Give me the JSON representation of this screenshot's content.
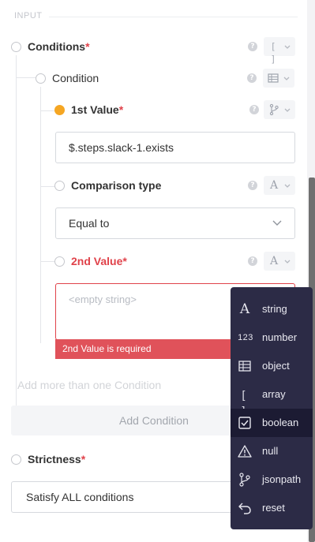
{
  "section": {
    "label": "INPUT"
  },
  "conditions": {
    "label": "Conditions",
    "required_mark": "*",
    "help": "?",
    "type_icon": "array-icon"
  },
  "condition": {
    "label": "Condition",
    "help": "?",
    "type_icon": "object-icon"
  },
  "first_value": {
    "label": "1st Value",
    "required_mark": "*",
    "help": "?",
    "value": "$.steps.slack-1.exists",
    "type_icon": "jsonpath-icon"
  },
  "comparison": {
    "label": "Comparison type",
    "help": "?",
    "selected": "Equal to",
    "type_icon": "string-icon"
  },
  "second_value": {
    "label": "2nd Value",
    "required_mark": "*",
    "help": "?",
    "placeholder": "<empty string>",
    "error": "2nd Value is required",
    "type_icon": "string-icon"
  },
  "add_more_hint": "Add more than one Condition",
  "add_condition_label": "Add Condition",
  "strictness": {
    "label": "Strictness",
    "required_mark": "*",
    "selected": "Satisfy ALL conditions"
  },
  "type_menu": {
    "items": [
      {
        "label": "string",
        "icon": "string-icon",
        "glyph": "A"
      },
      {
        "label": "number",
        "icon": "number-icon",
        "glyph": "123"
      },
      {
        "label": "object",
        "icon": "object-icon",
        "glyph": ""
      },
      {
        "label": "array",
        "icon": "array-icon",
        "glyph": "[ ]"
      },
      {
        "label": "boolean",
        "icon": "boolean-icon",
        "glyph": ""
      },
      {
        "label": "null",
        "icon": "null-icon",
        "glyph": ""
      },
      {
        "label": "jsonpath",
        "icon": "jsonpath-icon",
        "glyph": ""
      },
      {
        "label": "reset",
        "icon": "reset-icon",
        "glyph": ""
      }
    ],
    "active": "boolean"
  },
  "colors": {
    "accent": "#f5a623",
    "error": "#e0424a",
    "menu_bg": "#2c2b46"
  }
}
